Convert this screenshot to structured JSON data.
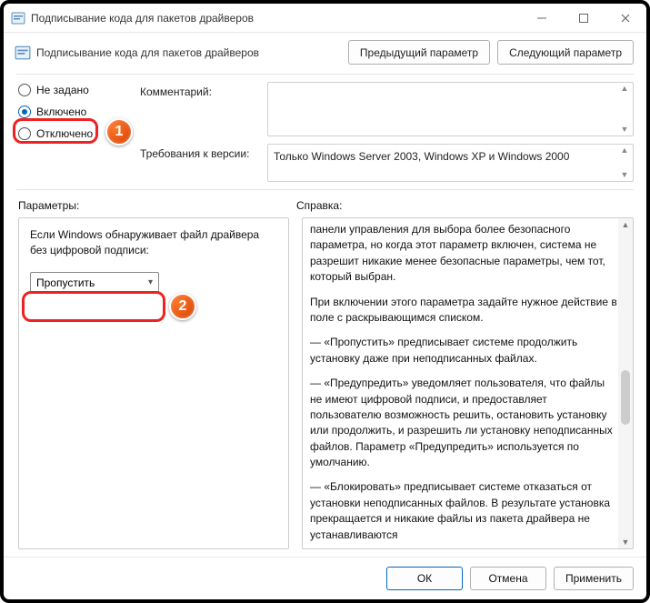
{
  "window": {
    "title": "Подписывание кода для пакетов драйверов"
  },
  "header": {
    "policy_name": "Подписывание кода для пакетов драйверов",
    "prev_btn": "Предыдущий параметр",
    "next_btn": "Следующий параметр"
  },
  "radios": {
    "not_configured": "Не задано",
    "enabled": "Включено",
    "disabled": "Отключено"
  },
  "comment_label": "Комментарий:",
  "requirements_label": "Требования к версии:",
  "requirements_text": "Только Windows Server 2003, Windows XP и Windows 2000",
  "options_label": "Параметры:",
  "help_label": "Справка:",
  "option_desc": "Если Windows обнаруживает файл драйвера без цифровой подписи:",
  "option_value": "Пропустить",
  "help": {
    "p1": "панели управления для выбора более безопасного параметра, но когда этот параметр включен, система не разрешит никакие менее безопасные параметры, чем тот, который выбран.",
    "p2": "При включении этого параметра задайте нужное действие в поле с раскрывающимся списком.",
    "p3": "—   «Пропустить» предписывает системе продолжить установку даже при неподписанных файлах.",
    "p4": "—   «Предупредить» уведомляет пользователя, что файлы не имеют цифровой подписи, и предоставляет пользователю возможность решить, остановить установку или продолжить, и разрешить ли установку неподписанных файлов. Параметр «Предупредить» используется по умолчанию.",
    "p5": "—   «Блокировать» предписывает системе отказаться от установки неподписанных файлов. В результате установка прекращается и никакие файлы из пакета драйвера не устанавливаются"
  },
  "buttons": {
    "ok": "ОК",
    "cancel": "Отмена",
    "apply": "Применить"
  },
  "annotations": {
    "one": "1",
    "two": "2"
  }
}
